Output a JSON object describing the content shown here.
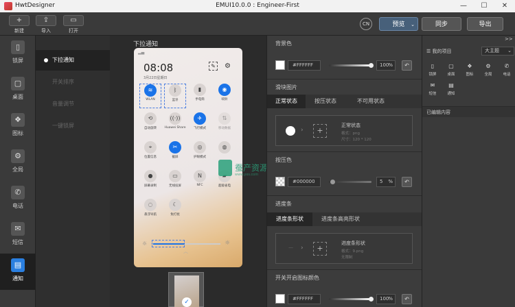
{
  "window": {
    "app_name": "HwtDesigner",
    "title": "EMUI10.0.0 : Engineer-First",
    "controls": [
      "—",
      "☐",
      "✕"
    ]
  },
  "toolbar": {
    "new_label": "新建",
    "import_label": "导入",
    "open_label": "打开",
    "lang_label": "CN",
    "preview_label": "预览",
    "sync_label": "同步",
    "export_label": "导出"
  },
  "left_nav": [
    {
      "label": "锁屏",
      "icon": "lockscreen-icon",
      "glyph": "▯"
    },
    {
      "label": "桌面",
      "icon": "desktop-icon",
      "glyph": "▢"
    },
    {
      "label": "图标",
      "icon": "icons-icon",
      "glyph": "❖"
    },
    {
      "label": "全局",
      "icon": "global-icon",
      "glyph": "⚙"
    },
    {
      "label": "电话",
      "icon": "phone-icon",
      "glyph": "✆"
    },
    {
      "label": "短信",
      "icon": "message-icon",
      "glyph": "✉"
    },
    {
      "label": "通知",
      "icon": "notification-icon",
      "glyph": "▤"
    }
  ],
  "sub_nav": [
    "下拉通知",
    "开关排序",
    "音量调节",
    "一键锁屏"
  ],
  "canvas": {
    "title": "下拉通知",
    "time": "08:08",
    "date": "3月22日星期日",
    "quick_settings": [
      {
        "label": "WLAN",
        "glyph": "≋",
        "on": true
      },
      {
        "label": "蓝牙",
        "glyph": "ᛒ",
        "on": false
      },
      {
        "label": "手电筒",
        "glyph": "▮",
        "on": false
      },
      {
        "label": "响铃",
        "glyph": "◉",
        "on": true
      },
      {
        "label": "自动旋转",
        "glyph": "⟲",
        "on": false
      },
      {
        "label": "Huawei Share",
        "glyph": "((·))",
        "on": false
      },
      {
        "label": "飞行模式",
        "glyph": "✈",
        "on": true
      },
      {
        "label": "移动数据",
        "glyph": "⇅",
        "on": false
      },
      {
        "label": "位置信息",
        "glyph": "⌖",
        "on": false
      },
      {
        "label": "截屏",
        "glyph": "✂",
        "on": true
      },
      {
        "label": "护眼模式",
        "glyph": "◎",
        "on": false
      },
      {
        "label": "",
        "glyph": "◍",
        "on": false
      },
      {
        "label": "屏幕录制",
        "glyph": "●",
        "on": false
      },
      {
        "label": "无线投屏",
        "glyph": "▭",
        "on": false
      },
      {
        "label": "NFC",
        "glyph": "N",
        "on": false
      },
      {
        "label": "超级省电",
        "glyph": "▰",
        "on": false
      },
      {
        "label": "悬浮导航",
        "glyph": "◌",
        "on": false
      },
      {
        "label": "免打扰",
        "glyph": "☾",
        "on": false
      }
    ]
  },
  "watermark": {
    "text": "蚕产资源网",
    "sub": "www.yxs.com"
  },
  "props": {
    "bg_color_title": "背景色",
    "bg_color_value": "#FFFFFF",
    "bg_opacity": "100",
    "slider_image_title": "滑块图片",
    "slider_tabs": [
      "正常状态",
      "按压状态",
      "不可用状态"
    ],
    "normal_state_name": "正常状态",
    "normal_state_format": "格式：png",
    "normal_state_size": "尺寸：120 * 120",
    "press_color_title": "按压色",
    "press_color_value": "#000000",
    "press_opacity": "5",
    "progress_title": "进度条",
    "progress_tabs": [
      "进度条形状",
      "进度条高亮形状"
    ],
    "progress_state_name": "进度条形状",
    "progress_state_format": "格式：9.png",
    "progress_state_size": "无限制",
    "switch_color_title": "开关开启图标颜色",
    "switch_color_value": "#FFFFFF",
    "switch_opacity": "100",
    "pct_unit": "%"
  },
  "right_panel": {
    "collapse_label": ">>",
    "my_project": "我的项目",
    "size_select": "大主题",
    "items": [
      {
        "label": "锁屏",
        "glyph": "▯"
      },
      {
        "label": "桌面",
        "glyph": "▢"
      },
      {
        "label": "图标",
        "glyph": "❖"
      },
      {
        "label": "全局",
        "glyph": "⚙"
      },
      {
        "label": "电话",
        "glyph": "✆"
      },
      {
        "label": "短信",
        "glyph": "✉"
      },
      {
        "label": "通知",
        "glyph": "▤"
      }
    ],
    "edited_label": "已编辑内容"
  },
  "colors": {
    "accent": "#1a73e8",
    "panel": "#3c3c3c"
  }
}
